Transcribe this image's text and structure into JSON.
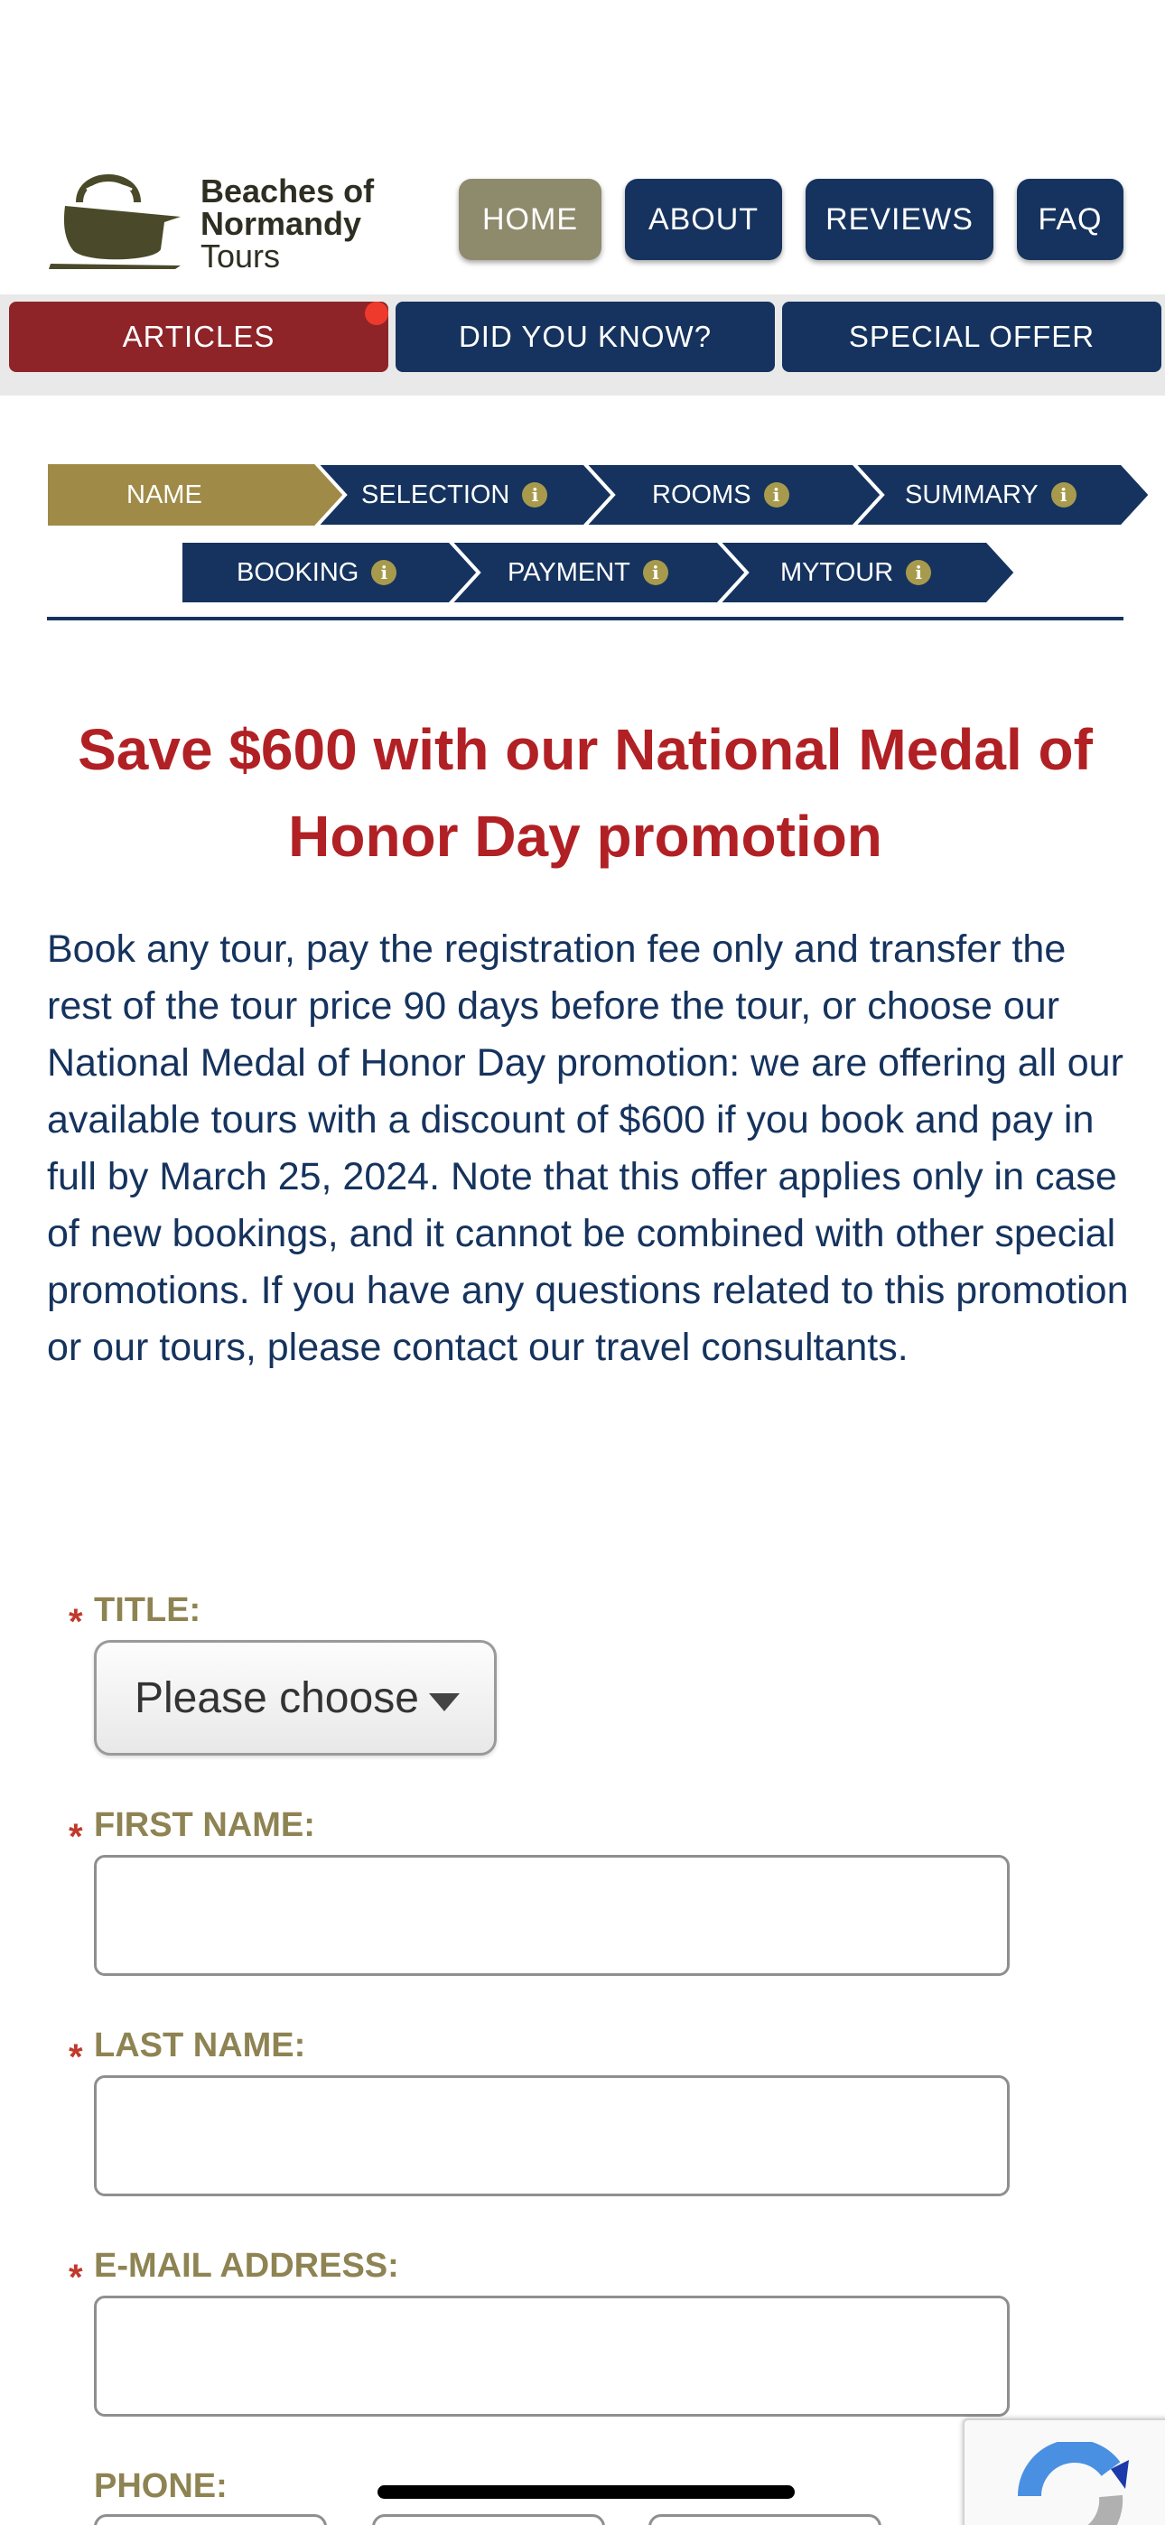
{
  "brand": {
    "name_line1": "Beaches of",
    "name_line2": "Normandy",
    "name_line3": "Tours"
  },
  "topnav": {
    "home": "HOME",
    "about": "ABOUT",
    "reviews": "REVIEWS",
    "faq": "FAQ"
  },
  "subnav": {
    "articles": "ARTICLES",
    "did_you_know": "DID YOU KNOW?",
    "special_offer": "SPECIAL OFFER"
  },
  "steps": {
    "name": "NAME",
    "selection": "SELECTION",
    "rooms": "ROOMS",
    "summary": "SUMMARY",
    "booking": "BOOKING",
    "payment": "PAYMENT",
    "mytour": "MYTOUR",
    "info_glyph": "i"
  },
  "promo": {
    "title": "Save $600 with our National Medal of Honor Day promotion",
    "body": "Book any tour, pay the registration fee only and transfer the rest of the tour price 90 days before the tour, or choose our National Medal of Honor Day promotion: we are offering all our available tours with a discount of $600 if you book and pay in full by March 25, 2024. Note that this offer applies only in case of new bookings, and it cannot be combined with other special promotions. If you have any questions related to this promotion or our tours, please contact our travel consultants."
  },
  "form": {
    "required_mark": "*",
    "title_label": "TITLE:",
    "title_value": "Please choose",
    "first_name_label": "FIRST NAME:",
    "last_name_label": "LAST NAME:",
    "email_label": "E-MAIL ADDRESS:",
    "phone_label": "PHONE:"
  },
  "colors": {
    "navy": "#15335e",
    "gold": "#a08a48",
    "red": "#b12024",
    "olive": "#8e8a6c"
  },
  "icons": {
    "logo": "cauldron-logo-icon",
    "select_arrow": "chevron-down-icon",
    "recaptcha": "recaptcha-icon"
  }
}
